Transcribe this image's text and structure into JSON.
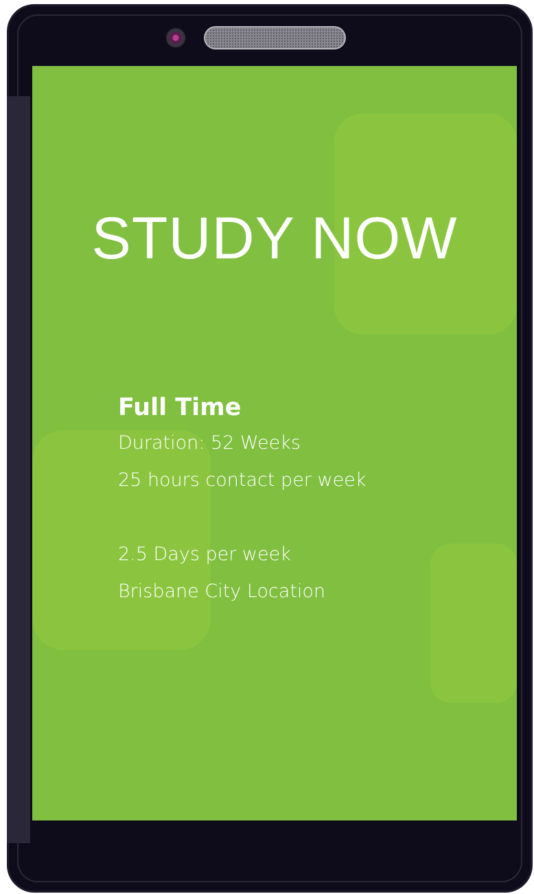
{
  "screen": {
    "title": "STUDY NOW",
    "heading": "Full Time",
    "lines": [
      "Duration: 52 Weeks",
      "25 hours contact per week",
      "2.5 Days per week",
      "Brisbane City Location"
    ]
  },
  "colors": {
    "screen_background": "#80bf40",
    "decoration": "#8dc63f",
    "text": "#ffffff",
    "phone_body": "#0e0b1a"
  },
  "icons": {
    "camera": "camera-lens-icon",
    "speaker": "speaker-grille-icon"
  }
}
